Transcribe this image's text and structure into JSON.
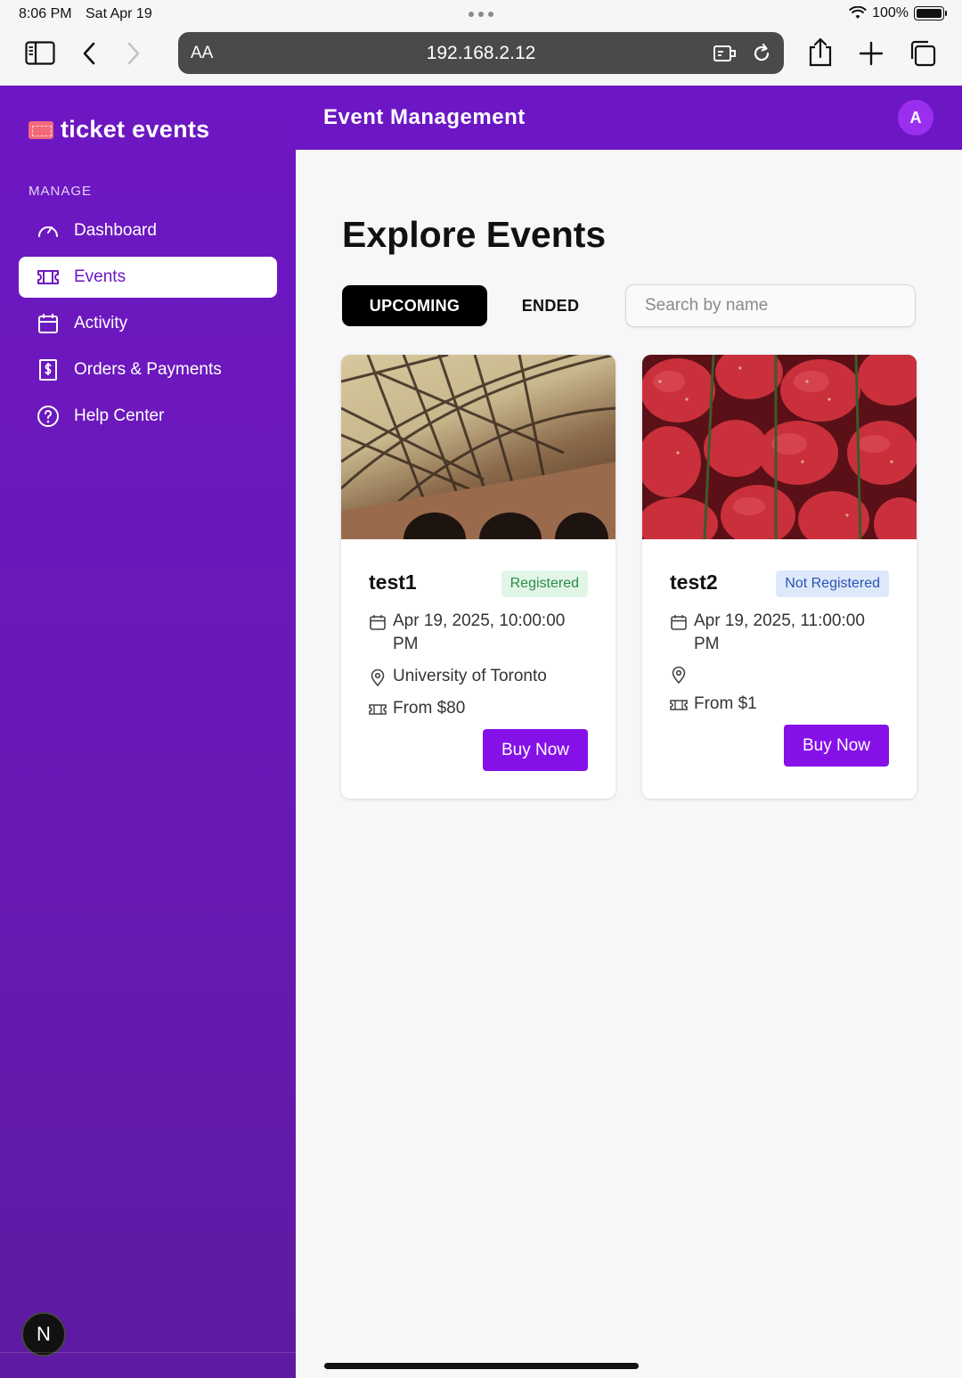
{
  "statusbar": {
    "time": "8:06 PM",
    "date": "Sat Apr 19",
    "battery": "100%"
  },
  "browser": {
    "text_size_label": "AA",
    "url": "192.168.2.12"
  },
  "sidebar": {
    "brand": "ticket events",
    "section_label": "MANAGE",
    "items": [
      {
        "label": "Dashboard",
        "icon": "gauge-icon",
        "active": false
      },
      {
        "label": "Events",
        "icon": "ticket-icon",
        "active": true
      },
      {
        "label": "Activity",
        "icon": "calendar-icon",
        "active": false
      },
      {
        "label": "Orders & Payments",
        "icon": "dollar-receipt-icon",
        "active": false
      },
      {
        "label": "Help Center",
        "icon": "help-circle-icon",
        "active": false
      }
    ],
    "dev_badge": "N"
  },
  "header": {
    "title": "Event Management",
    "avatar_initial": "A"
  },
  "main": {
    "title": "Explore Events",
    "tabs": [
      {
        "label": "UPCOMING",
        "active": true
      },
      {
        "label": "ENDED",
        "active": false
      }
    ],
    "search_placeholder": "Search by name",
    "events": [
      {
        "name": "test1",
        "status": "Registered",
        "datetime_line1": "Apr 19, 2025, 10:00:00",
        "datetime_line2": "PM",
        "location": "University of Toronto",
        "price": "From $80",
        "button": "Buy Now"
      },
      {
        "name": "test2",
        "status": "Not Registered",
        "datetime_line1": "Apr 19, 2025, 11:00:00",
        "datetime_line2": "PM",
        "location": "",
        "price": "From $1",
        "button": "Buy Now"
      }
    ]
  },
  "colors": {
    "brand_purple": "#6d17c4",
    "buy_button": "#8511e8",
    "registered": "#2d8a48",
    "not_registered": "#2a53b3"
  }
}
